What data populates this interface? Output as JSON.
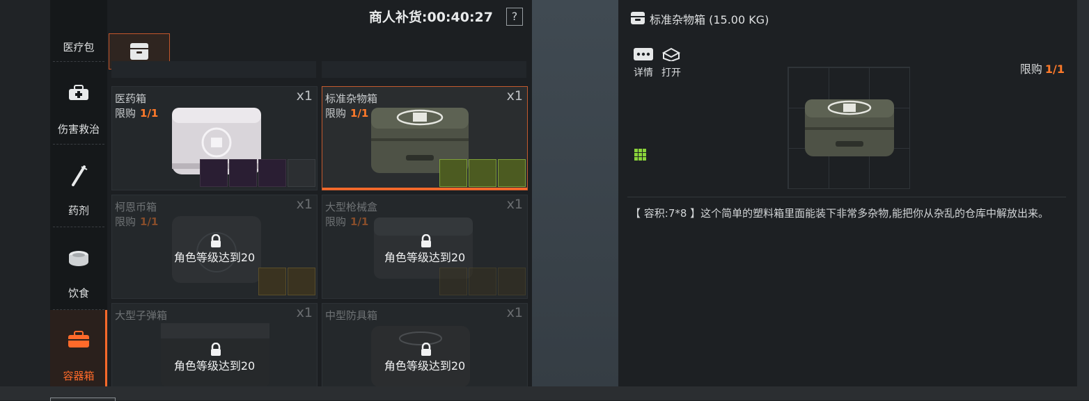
{
  "header": {
    "restock_label": "商人补货:00:40:27",
    "help_label": "?"
  },
  "sidebar": {
    "items": [
      {
        "label": "医疗包",
        "icon": "medkit-icon"
      },
      {
        "label": "伤害救治",
        "icon": "first-aid-bag-icon"
      },
      {
        "label": "药剂",
        "icon": "syringe-icon"
      },
      {
        "label": "饮食",
        "icon": "food-can-icon"
      },
      {
        "label": "容器箱",
        "icon": "container-box-icon",
        "active": true
      }
    ]
  },
  "cards": [
    {
      "name": "医药箱",
      "limit_label": "限购",
      "limit_value": "1/1",
      "qty": "x1"
    },
    {
      "name": "标准杂物箱",
      "limit_label": "限购",
      "limit_value": "1/1",
      "qty": "x1",
      "selected": true
    },
    {
      "name": "柯恩币箱",
      "limit_label": "限购",
      "limit_value": "1/1",
      "qty": "x1",
      "lock_text": "角色等级达到20"
    },
    {
      "name": "大型枪械盒",
      "limit_label": "限购",
      "limit_value": "1/1",
      "qty": "x1",
      "lock_text": "角色等级达到20"
    },
    {
      "name": "大型子弹箱",
      "qty": "x1",
      "lock_text": "角色等级达到20"
    },
    {
      "name": "中型防具箱",
      "qty": "x1",
      "lock_text": "角色等级达到20"
    }
  ],
  "detail": {
    "title": "标准杂物箱 (15.00 KG)",
    "details_label": "详情",
    "open_label": "打开",
    "limit_label": "限购",
    "limit_value": "1/1",
    "description": "【 容积:7*8 】这个简单的塑料箱里面能装下非常多杂物,能把你从杂乱的仓库中解放出来。"
  },
  "colors": {
    "accent": "#ff6a2a",
    "slot_green": "#7fa03a",
    "slot_purple": "#2a1e33"
  }
}
